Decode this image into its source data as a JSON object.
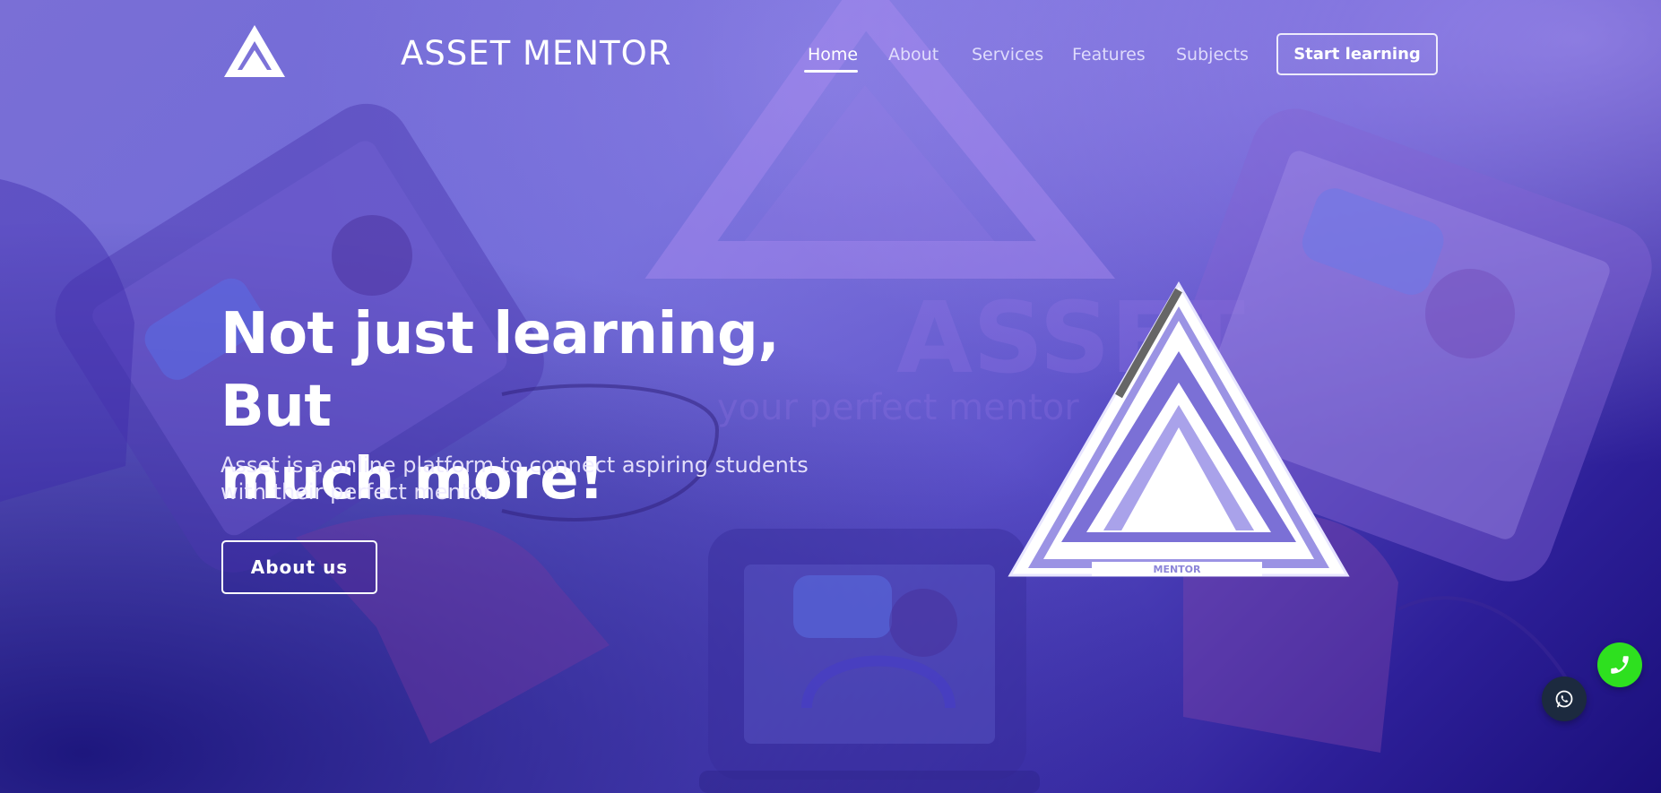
{
  "header": {
    "brand": "ASSET MENTOR",
    "nav": [
      {
        "label": "Home",
        "active": true
      },
      {
        "label": "About",
        "active": false
      },
      {
        "label": "Services",
        "active": false
      },
      {
        "label": "Features",
        "active": false
      },
      {
        "label": "Subjects",
        "active": false
      }
    ],
    "cta_label": "Start learning"
  },
  "hero": {
    "title_line1": "Not just learning, But",
    "title_line2": "much more!",
    "subtitle_line1": "Asset is a online platform to connect aspiring students",
    "subtitle_line2": "with their perfect mentor",
    "button_label": "About us",
    "logo_caption": "MENTOR"
  },
  "background_text": {
    "word": "ASSET",
    "tagline": "your perfect mentor"
  },
  "floating": {
    "call_icon": "phone-icon",
    "whatsapp_icon": "whatsapp-icon"
  },
  "colors": {
    "accent_green": "#2ee01f",
    "whatsapp_bg": "#1c2a3f",
    "primary_purple": "#5a4fc8"
  }
}
